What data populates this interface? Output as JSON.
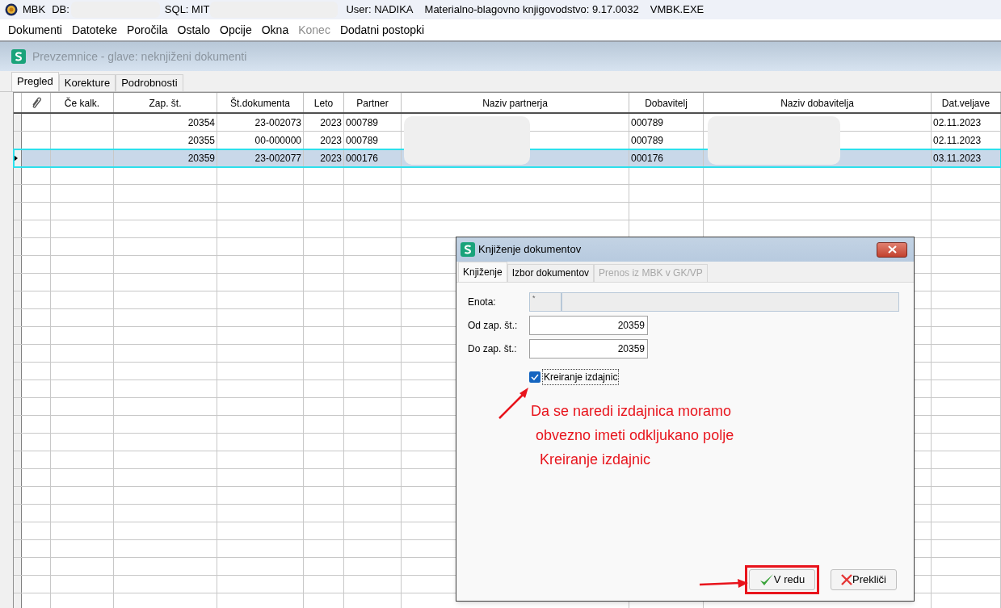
{
  "app_bar": {
    "items": [
      "MBK",
      "DB:",
      "SQL: MIT",
      "User: NADIKA",
      "Materialno-blagovno knjigovodstvo: 9.17.0032",
      "VMBK.EXE"
    ]
  },
  "menu": [
    {
      "label": "Dokumenti",
      "disabled": false
    },
    {
      "label": "Datoteke",
      "disabled": false
    },
    {
      "label": "Poročila",
      "disabled": false
    },
    {
      "label": "Ostalo",
      "disabled": false
    },
    {
      "label": "Opcije",
      "disabled": false
    },
    {
      "label": "Okna",
      "disabled": false
    },
    {
      "label": "Konec",
      "disabled": true
    },
    {
      "label": "Dodatni postopki",
      "disabled": false
    }
  ],
  "window": {
    "title": "Prevzemnice - glave: neknjiženi dokumenti"
  },
  "tabs": [
    {
      "label": "Pregled",
      "selected": true
    },
    {
      "label": "Korekture",
      "selected": false
    },
    {
      "label": "Podrobnosti",
      "selected": false
    }
  ],
  "table": {
    "columns": [
      "Če kalk.",
      "Zap. št.",
      "Št.dokumenta",
      "Leto",
      "Partner",
      "Naziv partnerja",
      "Dobavitelj",
      "Naziv dobavitelja",
      "Dat.veljave"
    ],
    "rows": [
      {
        "selected": false,
        "cells": [
          "",
          "20354",
          "23-002073",
          "2023",
          "000789",
          "",
          "000789",
          "",
          "02.11.2023"
        ]
      },
      {
        "selected": false,
        "cells": [
          "",
          "20355",
          "00-000000",
          "2023",
          "000789",
          "",
          "000789",
          "",
          "02.11.2023"
        ]
      },
      {
        "selected": true,
        "cells": [
          "",
          "20359",
          "23-002077",
          "2023",
          "000176",
          "",
          "000176",
          "",
          "03.11.2023"
        ]
      }
    ]
  },
  "dialog": {
    "title": "Knjiženje dokumentov",
    "tabs": [
      {
        "label": "Knjiženje",
        "selected": true,
        "disabled": false
      },
      {
        "label": "Izbor dokumentov",
        "selected": false,
        "disabled": false
      },
      {
        "label": "Prenos iz MBK v GK/VP",
        "selected": false,
        "disabled": true
      }
    ],
    "enota": {
      "label": "Enota:",
      "value": "*"
    },
    "fields": [
      {
        "label": "Od zap. št.:",
        "value": "20359"
      },
      {
        "label": "Do zap. št.:",
        "value": "20359"
      }
    ],
    "checkbox": {
      "label": "Kreiranje izdajnic",
      "checked": true
    },
    "buttons": [
      {
        "label": "V redu",
        "kind": "ok",
        "highlighted": true
      },
      {
        "label": "Prekliči",
        "kind": "cancel",
        "highlighted": false
      }
    ]
  },
  "annotation": {
    "lines": [
      "Da se naredi izdajnica moramo",
      "obvezno imeti odkljukano polje",
      "Kreiranje izdajnic"
    ]
  }
}
